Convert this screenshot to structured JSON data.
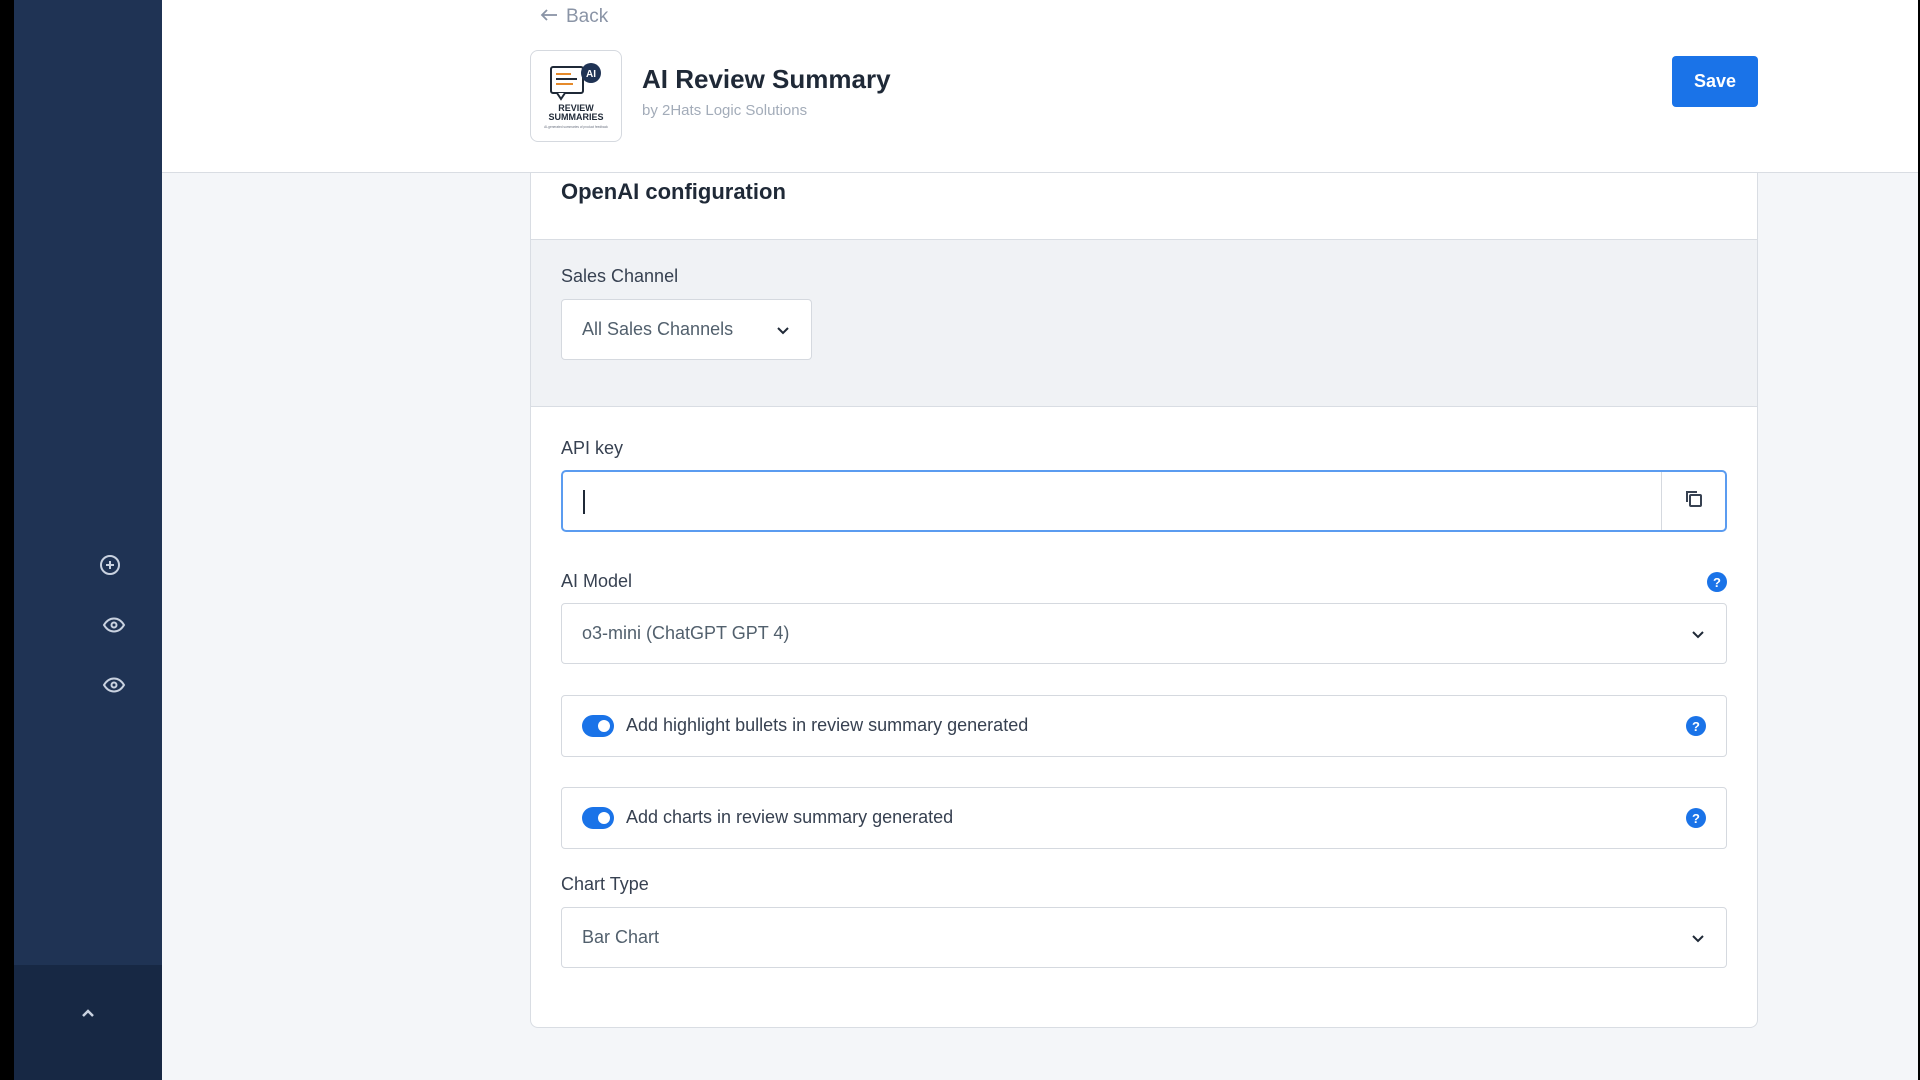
{
  "header": {
    "back_label": "Back",
    "app_title": "AI Review Summary",
    "app_vendor": "by 2Hats Logic Solutions",
    "save_label": "Save",
    "logo": {
      "badge": "AI",
      "line1": "REVIEW",
      "line2": "SUMMARIES",
      "tagline": "AI-generated summaries of product feedback"
    }
  },
  "card": {
    "title": "OpenAI configuration",
    "sales_channel": {
      "label": "Sales Channel",
      "value": "All Sales Channels"
    },
    "api_key": {
      "label": "API key",
      "value": ""
    },
    "ai_model": {
      "label": "AI Model",
      "value": "o3-mini (ChatGPT GPT 4)"
    },
    "toggles": [
      {
        "label": "Add highlight bullets in review summary generated",
        "enabled": true
      },
      {
        "label": "Add charts in review summary generated",
        "enabled": true
      }
    ],
    "chart_type": {
      "label": "Chart Type",
      "value": "Bar Chart"
    }
  },
  "sidebar": {
    "icons": [
      "plus-circle-icon",
      "eye-icon",
      "eye-icon",
      "chevron-up-icon"
    ]
  },
  "colors": {
    "accent": "#1a73e8",
    "sidebar": "#1f3354",
    "page_bg": "#f4f6f9"
  }
}
